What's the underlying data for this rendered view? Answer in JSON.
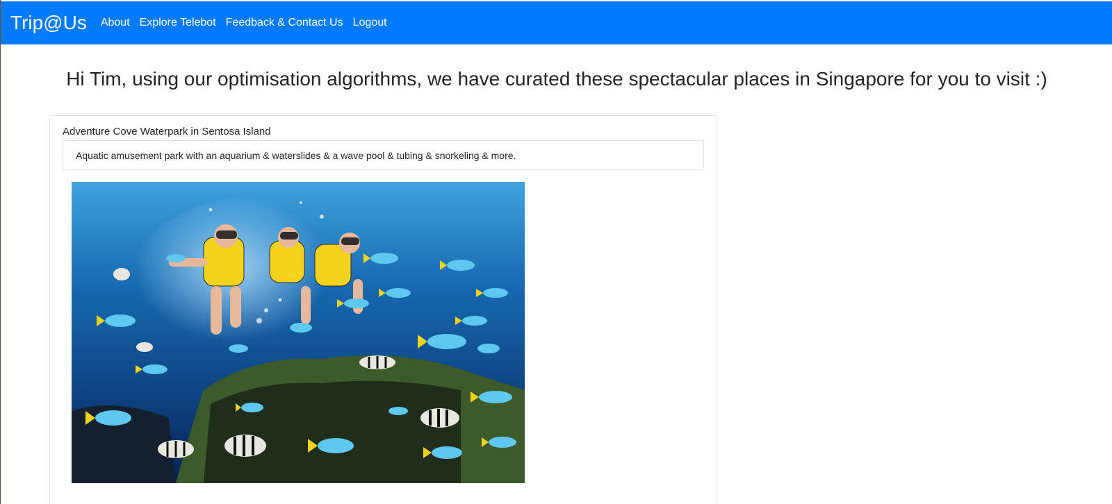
{
  "navbar": {
    "brand": "Trip@Us",
    "links": [
      "About",
      "Explore Telebot",
      "Feedback & Contact Us",
      "Logout"
    ]
  },
  "headline": "Hi Tim, using our optimisation algorithms, we have curated these spectacular places in Singapore for you to visit :)",
  "place": {
    "title": "Adventure Cove Waterpark in Sentosa Island",
    "description": "Aquatic amusement park with an aquarium & waterslides & a wave pool & tubing & snorkeling & more."
  },
  "colors": {
    "navbar": "#007bff",
    "nav_text": "#ffffff",
    "text": "#212529",
    "card_border": "#dfe3e6"
  }
}
